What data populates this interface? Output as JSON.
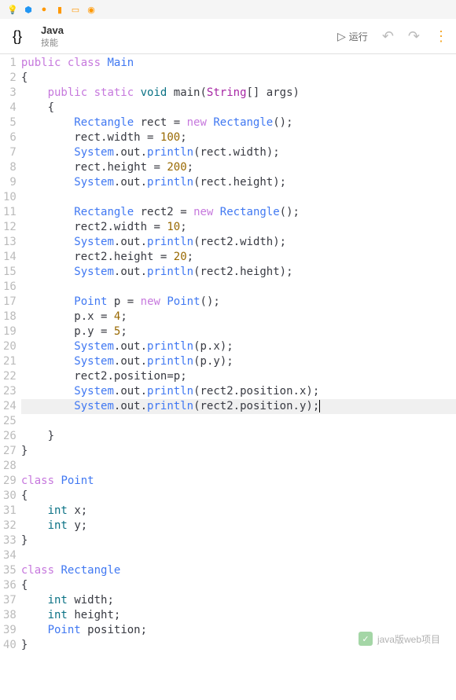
{
  "header": {
    "title": "Java",
    "subtitle": "技能",
    "run_label": "运行"
  },
  "code": {
    "lines": [
      {
        "n": 1,
        "t": [
          [
            "kw",
            "public"
          ],
          [
            "sp",
            " "
          ],
          [
            "kw",
            "class"
          ],
          [
            "sp",
            " "
          ],
          [
            "type",
            "Main"
          ]
        ]
      },
      {
        "n": 2,
        "t": [
          [
            "punc",
            "{"
          ]
        ]
      },
      {
        "n": 3,
        "t": [
          [
            "sp",
            "    "
          ],
          [
            "kw",
            "public"
          ],
          [
            "sp",
            " "
          ],
          [
            "kw",
            "static"
          ],
          [
            "sp",
            " "
          ],
          [
            "kw2",
            "void"
          ],
          [
            "sp",
            " "
          ],
          [
            "id",
            "main"
          ],
          [
            "punc",
            "("
          ],
          [
            "str-type",
            "String"
          ],
          [
            "punc",
            "[]"
          ],
          [
            "sp",
            " "
          ],
          [
            "id",
            "args"
          ],
          [
            "punc",
            ")"
          ]
        ]
      },
      {
        "n": 4,
        "t": [
          [
            "sp",
            "    "
          ],
          [
            "punc",
            "{"
          ]
        ]
      },
      {
        "n": 5,
        "t": [
          [
            "sp",
            "        "
          ],
          [
            "type",
            "Rectangle"
          ],
          [
            "sp",
            " "
          ],
          [
            "id",
            "rect"
          ],
          [
            "sp",
            " "
          ],
          [
            "punc",
            "="
          ],
          [
            "sp",
            " "
          ],
          [
            "kw",
            "new"
          ],
          [
            "sp",
            " "
          ],
          [
            "type",
            "Rectangle"
          ],
          [
            "punc",
            "();"
          ]
        ]
      },
      {
        "n": 6,
        "t": [
          [
            "sp",
            "        "
          ],
          [
            "id",
            "rect"
          ],
          [
            "punc",
            "."
          ],
          [
            "id",
            "width"
          ],
          [
            "sp",
            " "
          ],
          [
            "punc",
            "="
          ],
          [
            "sp",
            " "
          ],
          [
            "num",
            "100"
          ],
          [
            "punc",
            ";"
          ]
        ]
      },
      {
        "n": 7,
        "t": [
          [
            "sp",
            "        "
          ],
          [
            "type",
            "System"
          ],
          [
            "punc",
            "."
          ],
          [
            "id",
            "out"
          ],
          [
            "punc",
            "."
          ],
          [
            "method",
            "println"
          ],
          [
            "punc",
            "("
          ],
          [
            "id",
            "rect"
          ],
          [
            "punc",
            "."
          ],
          [
            "id",
            "width"
          ],
          [
            "punc",
            ");"
          ]
        ]
      },
      {
        "n": 8,
        "t": [
          [
            "sp",
            "        "
          ],
          [
            "id",
            "rect"
          ],
          [
            "punc",
            "."
          ],
          [
            "id",
            "height"
          ],
          [
            "sp",
            " "
          ],
          [
            "punc",
            "="
          ],
          [
            "sp",
            " "
          ],
          [
            "num",
            "200"
          ],
          [
            "punc",
            ";"
          ]
        ]
      },
      {
        "n": 9,
        "t": [
          [
            "sp",
            "        "
          ],
          [
            "type",
            "System"
          ],
          [
            "punc",
            "."
          ],
          [
            "id",
            "out"
          ],
          [
            "punc",
            "."
          ],
          [
            "method",
            "println"
          ],
          [
            "punc",
            "("
          ],
          [
            "id",
            "rect"
          ],
          [
            "punc",
            "."
          ],
          [
            "id",
            "height"
          ],
          [
            "punc",
            ");"
          ]
        ]
      },
      {
        "n": 10,
        "t": []
      },
      {
        "n": 11,
        "t": [
          [
            "sp",
            "        "
          ],
          [
            "type",
            "Rectangle"
          ],
          [
            "sp",
            " "
          ],
          [
            "id",
            "rect2"
          ],
          [
            "sp",
            " "
          ],
          [
            "punc",
            "="
          ],
          [
            "sp",
            " "
          ],
          [
            "kw",
            "new"
          ],
          [
            "sp",
            " "
          ],
          [
            "type",
            "Rectangle"
          ],
          [
            "punc",
            "();"
          ]
        ]
      },
      {
        "n": 12,
        "t": [
          [
            "sp",
            "        "
          ],
          [
            "id",
            "rect2"
          ],
          [
            "punc",
            "."
          ],
          [
            "id",
            "width"
          ],
          [
            "sp",
            " "
          ],
          [
            "punc",
            "="
          ],
          [
            "sp",
            " "
          ],
          [
            "num",
            "10"
          ],
          [
            "punc",
            ";"
          ]
        ]
      },
      {
        "n": 13,
        "t": [
          [
            "sp",
            "        "
          ],
          [
            "type",
            "System"
          ],
          [
            "punc",
            "."
          ],
          [
            "id",
            "out"
          ],
          [
            "punc",
            "."
          ],
          [
            "method",
            "println"
          ],
          [
            "punc",
            "("
          ],
          [
            "id",
            "rect2"
          ],
          [
            "punc",
            "."
          ],
          [
            "id",
            "width"
          ],
          [
            "punc",
            ");"
          ]
        ]
      },
      {
        "n": 14,
        "t": [
          [
            "sp",
            "        "
          ],
          [
            "id",
            "rect2"
          ],
          [
            "punc",
            "."
          ],
          [
            "id",
            "height"
          ],
          [
            "sp",
            " "
          ],
          [
            "punc",
            "="
          ],
          [
            "sp",
            " "
          ],
          [
            "num",
            "20"
          ],
          [
            "punc",
            ";"
          ]
        ]
      },
      {
        "n": 15,
        "t": [
          [
            "sp",
            "        "
          ],
          [
            "type",
            "System"
          ],
          [
            "punc",
            "."
          ],
          [
            "id",
            "out"
          ],
          [
            "punc",
            "."
          ],
          [
            "method",
            "println"
          ],
          [
            "punc",
            "("
          ],
          [
            "id",
            "rect2"
          ],
          [
            "punc",
            "."
          ],
          [
            "id",
            "height"
          ],
          [
            "punc",
            ");"
          ]
        ]
      },
      {
        "n": 16,
        "t": []
      },
      {
        "n": 17,
        "t": [
          [
            "sp",
            "        "
          ],
          [
            "type",
            "Point"
          ],
          [
            "sp",
            " "
          ],
          [
            "id",
            "p"
          ],
          [
            "sp",
            " "
          ],
          [
            "punc",
            "="
          ],
          [
            "sp",
            " "
          ],
          [
            "kw",
            "new"
          ],
          [
            "sp",
            " "
          ],
          [
            "type",
            "Point"
          ],
          [
            "punc",
            "();"
          ]
        ]
      },
      {
        "n": 18,
        "t": [
          [
            "sp",
            "        "
          ],
          [
            "id",
            "p"
          ],
          [
            "punc",
            "."
          ],
          [
            "id",
            "x"
          ],
          [
            "sp",
            " "
          ],
          [
            "punc",
            "="
          ],
          [
            "sp",
            " "
          ],
          [
            "num",
            "4"
          ],
          [
            "punc",
            ";"
          ]
        ]
      },
      {
        "n": 19,
        "t": [
          [
            "sp",
            "        "
          ],
          [
            "id",
            "p"
          ],
          [
            "punc",
            "."
          ],
          [
            "id",
            "y"
          ],
          [
            "sp",
            " "
          ],
          [
            "punc",
            "="
          ],
          [
            "sp",
            " "
          ],
          [
            "num",
            "5"
          ],
          [
            "punc",
            ";"
          ]
        ]
      },
      {
        "n": 20,
        "t": [
          [
            "sp",
            "        "
          ],
          [
            "type",
            "System"
          ],
          [
            "punc",
            "."
          ],
          [
            "id",
            "out"
          ],
          [
            "punc",
            "."
          ],
          [
            "method",
            "println"
          ],
          [
            "punc",
            "("
          ],
          [
            "id",
            "p"
          ],
          [
            "punc",
            "."
          ],
          [
            "id",
            "x"
          ],
          [
            "punc",
            ");"
          ]
        ]
      },
      {
        "n": 21,
        "t": [
          [
            "sp",
            "        "
          ],
          [
            "type",
            "System"
          ],
          [
            "punc",
            "."
          ],
          [
            "id",
            "out"
          ],
          [
            "punc",
            "."
          ],
          [
            "method",
            "println"
          ],
          [
            "punc",
            "("
          ],
          [
            "id",
            "p"
          ],
          [
            "punc",
            "."
          ],
          [
            "id",
            "y"
          ],
          [
            "punc",
            ");"
          ]
        ]
      },
      {
        "n": 22,
        "t": [
          [
            "sp",
            "        "
          ],
          [
            "id",
            "rect2"
          ],
          [
            "punc",
            "."
          ],
          [
            "id",
            "position"
          ],
          [
            "punc",
            "="
          ],
          [
            "id",
            "p"
          ],
          [
            "punc",
            ";"
          ]
        ]
      },
      {
        "n": 23,
        "t": [
          [
            "sp",
            "        "
          ],
          [
            "type",
            "System"
          ],
          [
            "punc",
            "."
          ],
          [
            "id",
            "out"
          ],
          [
            "punc",
            "."
          ],
          [
            "method",
            "println"
          ],
          [
            "punc",
            "("
          ],
          [
            "id",
            "rect2"
          ],
          [
            "punc",
            "."
          ],
          [
            "id",
            "position"
          ],
          [
            "punc",
            "."
          ],
          [
            "id",
            "x"
          ],
          [
            "punc",
            ");"
          ]
        ]
      },
      {
        "n": 24,
        "hl": true,
        "cursor": true,
        "t": [
          [
            "sp",
            "        "
          ],
          [
            "type",
            "System"
          ],
          [
            "punc",
            "."
          ],
          [
            "id",
            "out"
          ],
          [
            "punc",
            "."
          ],
          [
            "method",
            "println"
          ],
          [
            "punc",
            "("
          ],
          [
            "id",
            "rect2"
          ],
          [
            "punc",
            "."
          ],
          [
            "id",
            "position"
          ],
          [
            "punc",
            "."
          ],
          [
            "id",
            "y"
          ],
          [
            "punc",
            ");"
          ]
        ]
      },
      {
        "n": 25,
        "t": []
      },
      {
        "n": 26,
        "t": [
          [
            "sp",
            "    "
          ],
          [
            "punc",
            "}"
          ]
        ]
      },
      {
        "n": 27,
        "t": [
          [
            "punc",
            "}"
          ]
        ]
      },
      {
        "n": 28,
        "t": []
      },
      {
        "n": 29,
        "t": [
          [
            "kw",
            "class"
          ],
          [
            "sp",
            " "
          ],
          [
            "type",
            "Point"
          ]
        ]
      },
      {
        "n": 30,
        "t": [
          [
            "punc",
            "{"
          ]
        ]
      },
      {
        "n": 31,
        "t": [
          [
            "sp",
            "    "
          ],
          [
            "kw2",
            "int"
          ],
          [
            "sp",
            " "
          ],
          [
            "id",
            "x"
          ],
          [
            "punc",
            ";"
          ]
        ]
      },
      {
        "n": 32,
        "t": [
          [
            "sp",
            "    "
          ],
          [
            "kw2",
            "int"
          ],
          [
            "sp",
            " "
          ],
          [
            "id",
            "y"
          ],
          [
            "punc",
            ";"
          ]
        ]
      },
      {
        "n": 33,
        "t": [
          [
            "punc",
            "}"
          ]
        ]
      },
      {
        "n": 34,
        "t": []
      },
      {
        "n": 35,
        "t": [
          [
            "kw",
            "class"
          ],
          [
            "sp",
            " "
          ],
          [
            "type",
            "Rectangle"
          ]
        ]
      },
      {
        "n": 36,
        "t": [
          [
            "punc",
            "{"
          ]
        ]
      },
      {
        "n": 37,
        "t": [
          [
            "sp",
            "    "
          ],
          [
            "kw2",
            "int"
          ],
          [
            "sp",
            " "
          ],
          [
            "id",
            "width"
          ],
          [
            "punc",
            ";"
          ]
        ]
      },
      {
        "n": 38,
        "t": [
          [
            "sp",
            "    "
          ],
          [
            "kw2",
            "int"
          ],
          [
            "sp",
            " "
          ],
          [
            "id",
            "height"
          ],
          [
            "punc",
            ";"
          ]
        ]
      },
      {
        "n": 39,
        "t": [
          [
            "sp",
            "    "
          ],
          [
            "type",
            "Point"
          ],
          [
            "sp",
            " "
          ],
          [
            "id",
            "position"
          ],
          [
            "punc",
            ";"
          ]
        ]
      },
      {
        "n": 40,
        "t": [
          [
            "punc",
            "}"
          ]
        ]
      }
    ]
  },
  "watermark": {
    "text": "java版web项目"
  }
}
